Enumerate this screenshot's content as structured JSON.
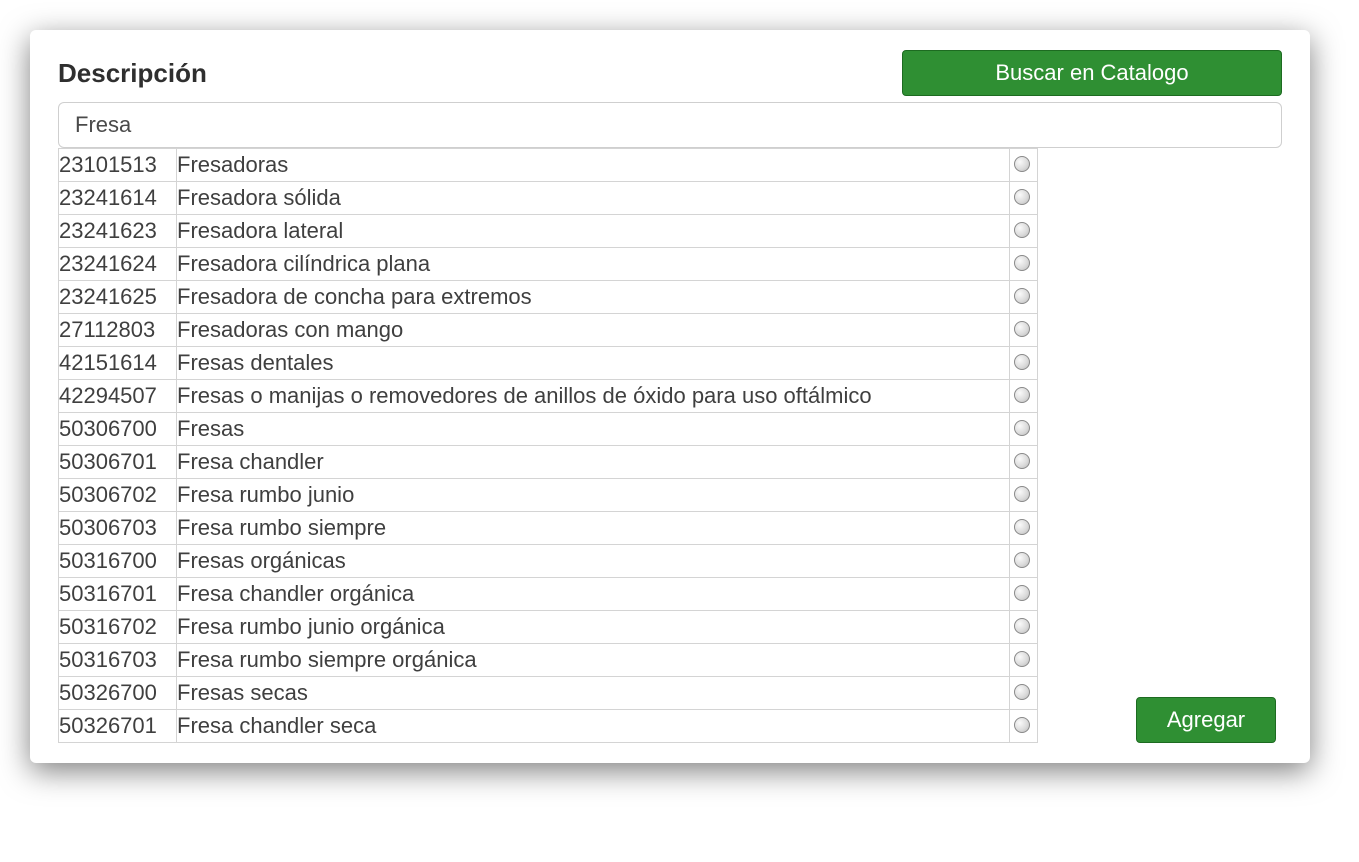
{
  "header": {
    "title": "Descripción",
    "catalog_button": "Buscar en Catalogo"
  },
  "search": {
    "value": "Fresa",
    "placeholder": ""
  },
  "results": [
    {
      "code": "23101513",
      "desc": "Fresadoras"
    },
    {
      "code": "23241614",
      "desc": "Fresadora sólida"
    },
    {
      "code": "23241623",
      "desc": "Fresadora lateral"
    },
    {
      "code": "23241624",
      "desc": "Fresadora cilíndrica plana"
    },
    {
      "code": "23241625",
      "desc": "Fresadora de concha para extremos"
    },
    {
      "code": "27112803",
      "desc": "Fresadoras con mango"
    },
    {
      "code": "42151614",
      "desc": "Fresas dentales"
    },
    {
      "code": "42294507",
      "desc": "Fresas o manijas o removedores de anillos de óxido para uso oftálmico"
    },
    {
      "code": "50306700",
      "desc": "Fresas"
    },
    {
      "code": "50306701",
      "desc": "Fresa chandler"
    },
    {
      "code": "50306702",
      "desc": "Fresa rumbo junio"
    },
    {
      "code": "50306703",
      "desc": "Fresa rumbo siempre"
    },
    {
      "code": "50316700",
      "desc": "Fresas orgánicas"
    },
    {
      "code": "50316701",
      "desc": "Fresa chandler orgánica"
    },
    {
      "code": "50316702",
      "desc": "Fresa rumbo junio orgánica"
    },
    {
      "code": "50316703",
      "desc": "Fresa rumbo siempre orgánica"
    },
    {
      "code": "50326700",
      "desc": "Fresas secas"
    },
    {
      "code": "50326701",
      "desc": "Fresa chandler seca"
    }
  ],
  "actions": {
    "add_button": "Agregar"
  }
}
